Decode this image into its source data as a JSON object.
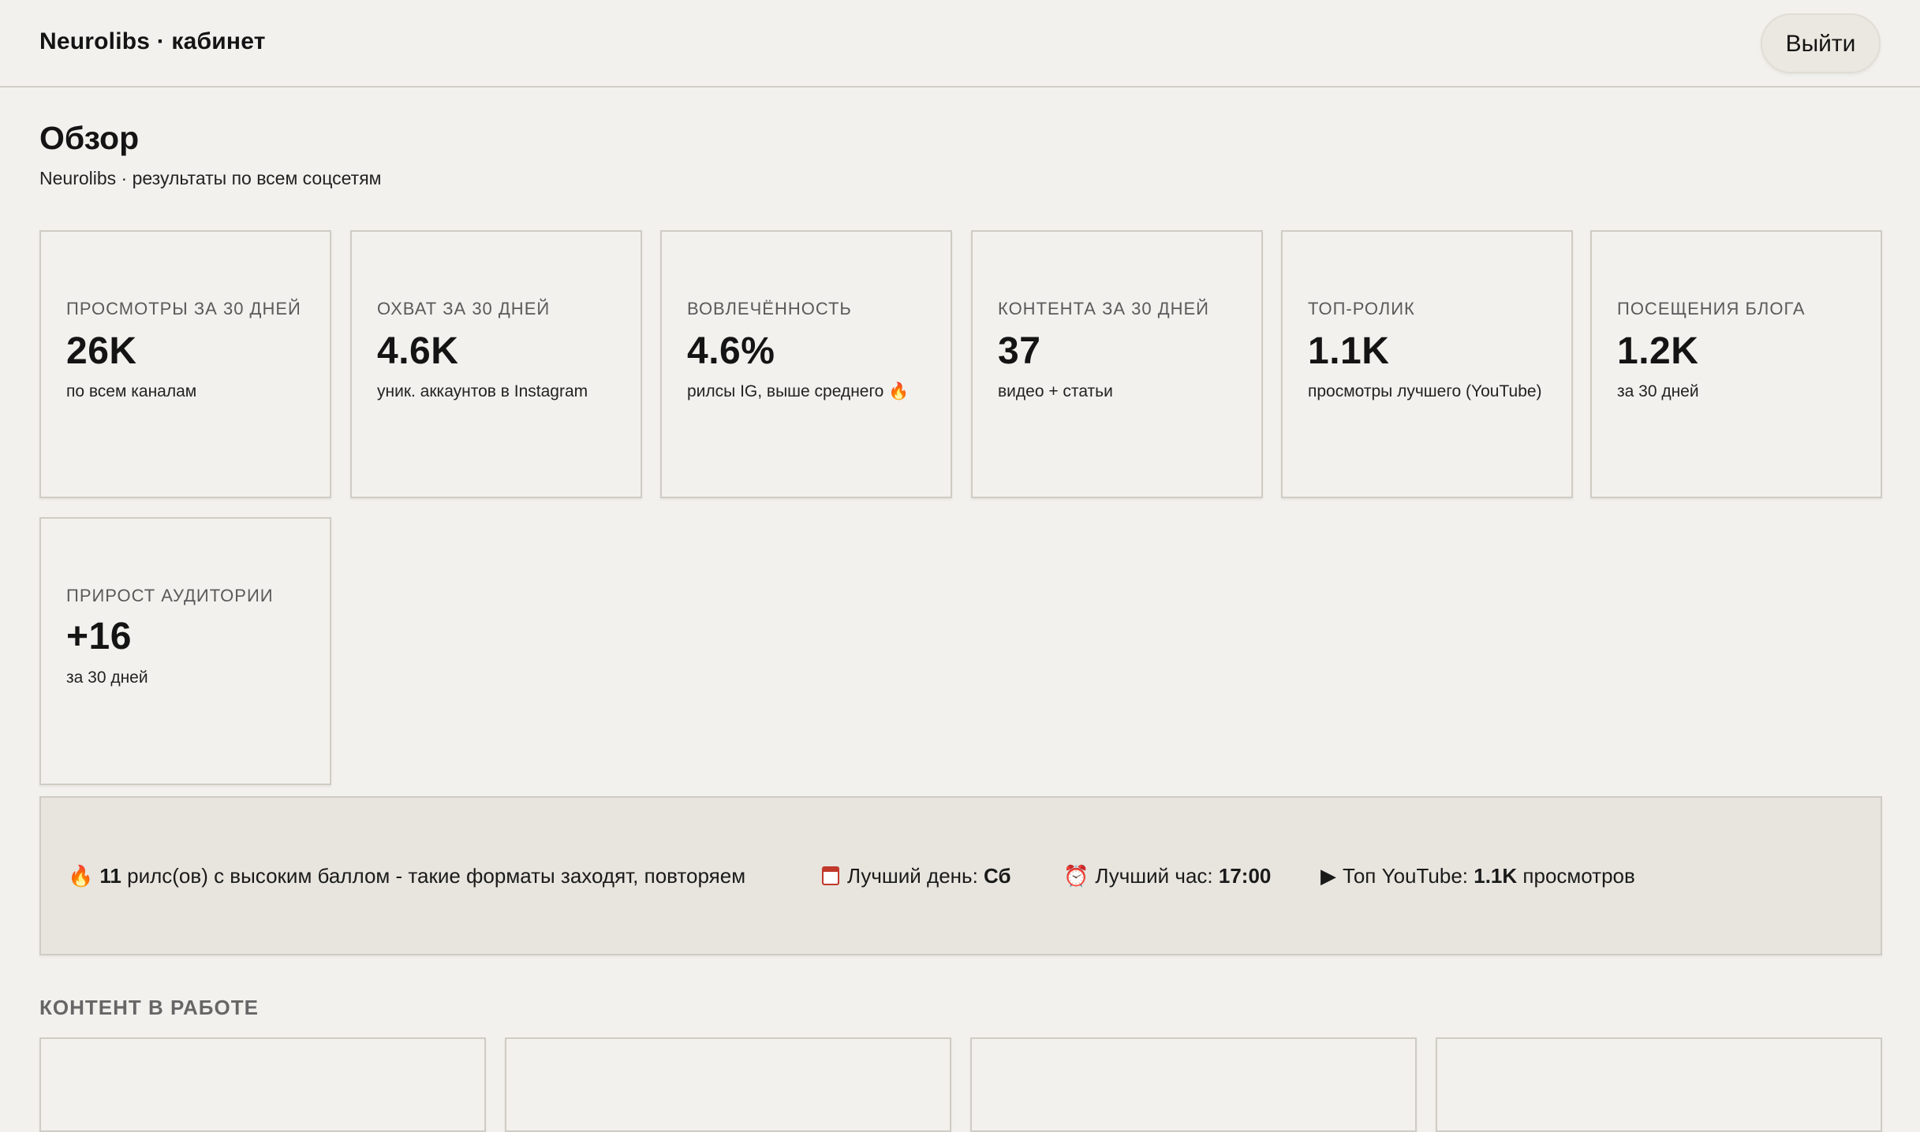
{
  "header": {
    "brand": "Neurolibs · кабинет",
    "logout_label": "Выйти"
  },
  "overview": {
    "title": "Обзор",
    "subtitle": "Neurolibs · результаты по всем соцсетям"
  },
  "stats": [
    {
      "label": "Просмотры за 30 дней",
      "value": "26K",
      "note": "по всем каналам"
    },
    {
      "label": "Охват за 30 дней",
      "value": "4.6K",
      "note": "уник. аккаунтов в Instagram"
    },
    {
      "label": "Вовлечённость",
      "value": "4.6%",
      "note": "рилсы IG, выше среднего 🔥"
    },
    {
      "label": "Контента за 30 дней",
      "value": "37",
      "note": "видео + статьи"
    },
    {
      "label": "Топ-ролик",
      "value": "1.1K",
      "note": "просмотры лучшего (YouTube)"
    },
    {
      "label": "Посещения блога",
      "value": "1.2K",
      "note": "за 30 дней"
    },
    {
      "label": "Прирост аудитории",
      "value": "+16",
      "note": "за 30 дней"
    }
  ],
  "insights": {
    "reels_count": "11",
    "reels_text": "рилс(ов) с высоким баллом - такие форматы заходят, повторяем",
    "best_day_label": "Лучший день:",
    "best_day_value": "Сб",
    "best_hour_label": "Лучший час:",
    "best_hour_value": "17:00",
    "top_youtube_label": "Топ YouTube:",
    "top_youtube_value": "1.1K",
    "top_youtube_suffix": "просмотров",
    "icons": [
      "fire-icon",
      "calendar-icon",
      "alarm-clock-icon",
      "play-icon"
    ]
  },
  "work_section": {
    "title": "КОНТЕНТ В РАБОТЕ"
  }
}
